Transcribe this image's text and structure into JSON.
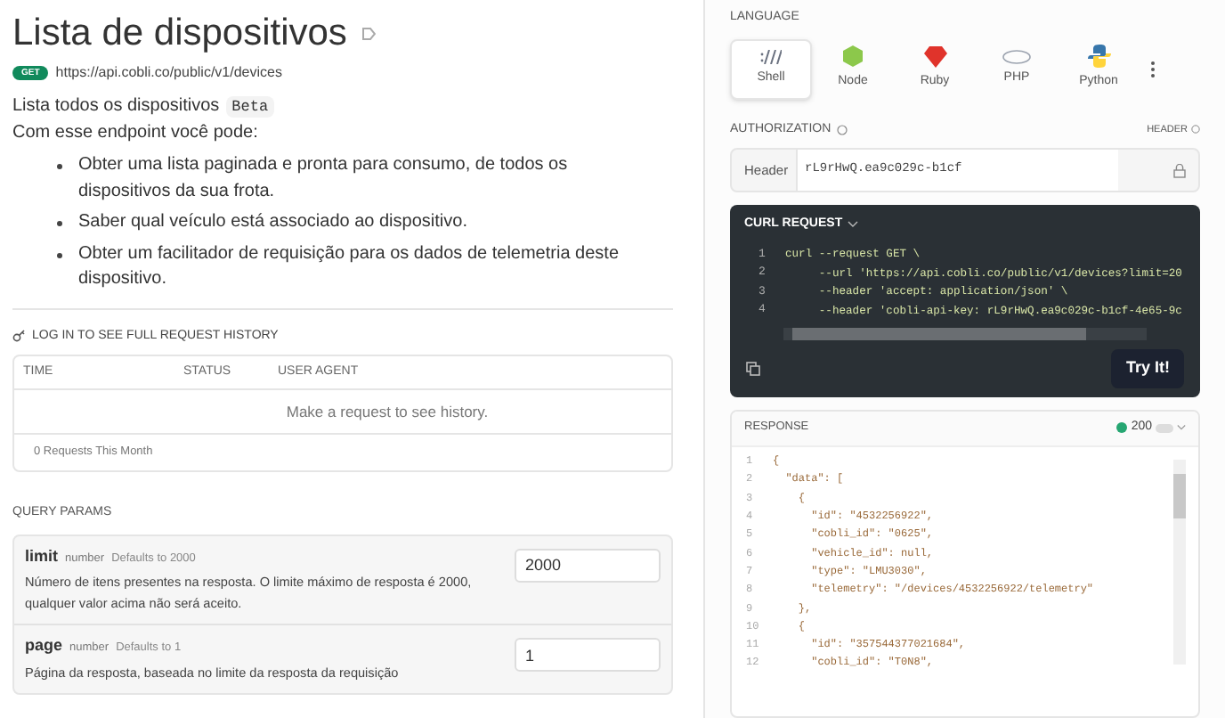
{
  "page": {
    "title": "Lista de dispositivos",
    "method": "GET",
    "url": "https://api.cobli.co/public/v1/devices",
    "summary": "Lista todos os dispositivos",
    "summary_badge": "Beta",
    "intro": "Com esse endpoint você pode:",
    "bullets": [
      "Obter uma lista paginada e pronta para consumo, de todos os dispositivos da sua frota.",
      "Saber qual veículo está associado ao dispositivo.",
      "Obter um facilitador de requisição para os dados de telemetria deste dispositivo."
    ]
  },
  "history": {
    "login_link": "LOG IN TO SEE FULL REQUEST HISTORY",
    "columns": [
      "TIME",
      "STATUS",
      "USER AGENT"
    ],
    "empty_message": "Make a request to see history.",
    "footer": "0 Requests This Month"
  },
  "query_params": {
    "title": "QUERY PARAMS",
    "params": [
      {
        "name": "limit",
        "type": "number",
        "default": "Defaults to 2000",
        "description": "Número de itens presentes na resposta. O limite máximo de resposta é 2000, qualquer valor acima não será aceito.",
        "value": "2000"
      },
      {
        "name": "page",
        "type": "number",
        "default": "Defaults to 1",
        "description": "Página da resposta, baseada no limite da resposta da requisição",
        "value": "1"
      }
    ]
  },
  "language": {
    "title": "LANGUAGE",
    "options": [
      {
        "label": "Shell",
        "kind": "shell",
        "selected": true
      },
      {
        "label": "Node",
        "kind": "node",
        "selected": false
      },
      {
        "label": "Ruby",
        "kind": "ruby",
        "selected": false
      },
      {
        "label": "PHP",
        "kind": "php",
        "selected": false
      },
      {
        "label": "Python",
        "kind": "python",
        "selected": false
      }
    ]
  },
  "authorization": {
    "title": "AUTHORIZATION",
    "location": "HEADER",
    "field_label": "Header",
    "value": "rL9rHwQ.ea9c029c-b1cf"
  },
  "curl": {
    "title": "CURL REQUEST",
    "lines": [
      {
        "number": "1",
        "text": "curl --request GET \\"
      },
      {
        "number": "2",
        "text": "     --url 'https://api.cobli.co/public/v1/devices?limit=20"
      },
      {
        "number": "3",
        "text": "     --header 'accept: application/json' \\"
      },
      {
        "number": "4",
        "text": "     --header 'cobli-api-key: rL9rHwQ.ea9c029c-b1cf-4e65-9c"
      }
    ],
    "button": "Try It!"
  },
  "response": {
    "title": "RESPONSE",
    "status": "200",
    "lines": [
      {
        "number": "1",
        "text": "{"
      },
      {
        "number": "2",
        "text": "  \"data\": ["
      },
      {
        "number": "3",
        "text": "    {"
      },
      {
        "number": "4",
        "text": "      \"id\": \"4532256922\","
      },
      {
        "number": "5",
        "text": "      \"cobli_id\": \"0625\","
      },
      {
        "number": "6",
        "text": "      \"vehicle_id\": null,"
      },
      {
        "number": "7",
        "text": "      \"type\": \"LMU3030\","
      },
      {
        "number": "8",
        "text": "      \"telemetry\": \"/devices/4532256922/telemetry\""
      },
      {
        "number": "9",
        "text": "    },"
      },
      {
        "number": "10",
        "text": "    {"
      },
      {
        "number": "11",
        "text": "      \"id\": \"357544377021684\","
      },
      {
        "number": "12",
        "text": "      \"cobli_id\": \"T0N8\","
      }
    ]
  }
}
